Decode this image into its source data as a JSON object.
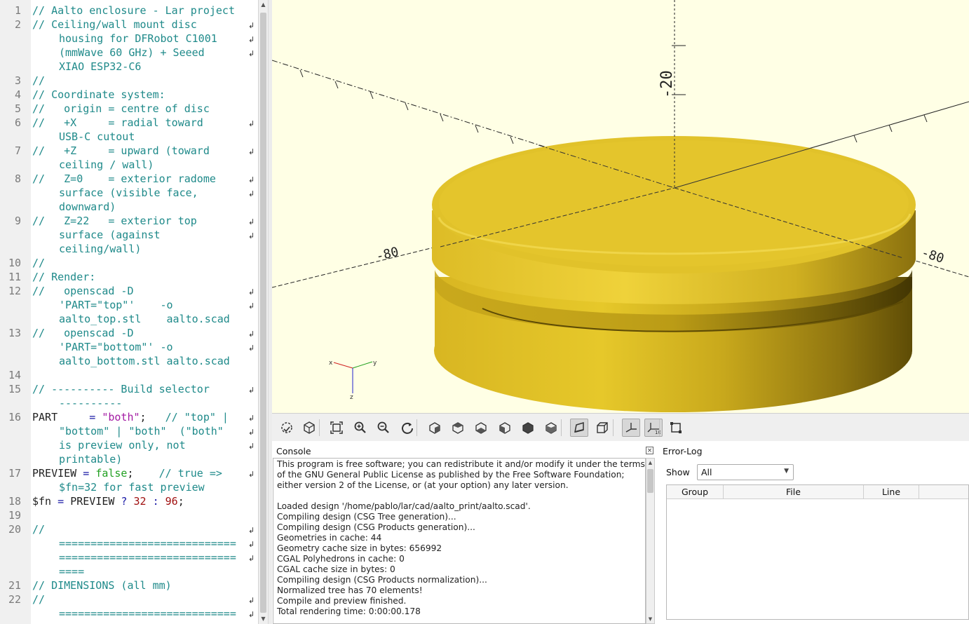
{
  "editor": {
    "lines": [
      {
        "n": "1",
        "rows": [
          {
            "w": false,
            "parts": [
              {
                "t": "// Aalto enclosure - Lar project",
                "c": "cmt"
              }
            ]
          }
        ]
      },
      {
        "n": "2",
        "rows": [
          {
            "w": false,
            "wrap": true,
            "parts": [
              {
                "t": "// Ceiling/wall mount disc",
                "c": "cmt"
              }
            ]
          },
          {
            "w": true,
            "wrap": true,
            "parts": [
              {
                "t": "housing for DFRobot C1001",
                "c": "cmt"
              }
            ]
          },
          {
            "w": true,
            "wrap": true,
            "parts": [
              {
                "t": "(mmWave 60 GHz) + Seeed",
                "c": "cmt"
              }
            ]
          },
          {
            "w": true,
            "parts": [
              {
                "t": "XIAO ESP32-C6",
                "c": "cmt"
              }
            ]
          }
        ]
      },
      {
        "n": "3",
        "rows": [
          {
            "w": false,
            "parts": [
              {
                "t": "//",
                "c": "cmt"
              }
            ]
          }
        ]
      },
      {
        "n": "4",
        "rows": [
          {
            "w": false,
            "parts": [
              {
                "t": "// Coordinate system:",
                "c": "cmt"
              }
            ]
          }
        ]
      },
      {
        "n": "5",
        "rows": [
          {
            "w": false,
            "parts": [
              {
                "t": "//   origin = centre of disc",
                "c": "cmt"
              }
            ]
          }
        ]
      },
      {
        "n": "6",
        "rows": [
          {
            "w": false,
            "wrap": true,
            "parts": [
              {
                "t": "//   +X     = radial toward",
                "c": "cmt"
              }
            ]
          },
          {
            "w": true,
            "parts": [
              {
                "t": "USB-C cutout",
                "c": "cmt"
              }
            ]
          }
        ]
      },
      {
        "n": "7",
        "rows": [
          {
            "w": false,
            "wrap": true,
            "parts": [
              {
                "t": "//   +Z     = upward (toward",
                "c": "cmt"
              }
            ]
          },
          {
            "w": true,
            "parts": [
              {
                "t": "ceiling / wall)",
                "c": "cmt"
              }
            ]
          }
        ]
      },
      {
        "n": "8",
        "rows": [
          {
            "w": false,
            "wrap": true,
            "parts": [
              {
                "t": "//   Z=0    = exterior radome",
                "c": "cmt"
              }
            ]
          },
          {
            "w": true,
            "wrap": true,
            "parts": [
              {
                "t": "surface (visible face,",
                "c": "cmt"
              }
            ]
          },
          {
            "w": true,
            "parts": [
              {
                "t": "downward)",
                "c": "cmt"
              }
            ]
          }
        ]
      },
      {
        "n": "9",
        "rows": [
          {
            "w": false,
            "wrap": true,
            "parts": [
              {
                "t": "//   Z=22   = exterior top",
                "c": "cmt"
              }
            ]
          },
          {
            "w": true,
            "wrap": true,
            "parts": [
              {
                "t": "surface (against",
                "c": "cmt"
              }
            ]
          },
          {
            "w": true,
            "parts": [
              {
                "t": "ceiling/wall)",
                "c": "cmt"
              }
            ]
          }
        ]
      },
      {
        "n": "10",
        "rows": [
          {
            "w": false,
            "parts": [
              {
                "t": "//",
                "c": "cmt"
              }
            ]
          }
        ]
      },
      {
        "n": "11",
        "rows": [
          {
            "w": false,
            "parts": [
              {
                "t": "// Render:",
                "c": "cmt"
              }
            ]
          }
        ]
      },
      {
        "n": "12",
        "rows": [
          {
            "w": false,
            "wrap": true,
            "parts": [
              {
                "t": "//   openscad -D",
                "c": "cmt"
              }
            ]
          },
          {
            "w": true,
            "wrap": true,
            "parts": [
              {
                "t": "'PART=\"top\"'    -o",
                "c": "cmt"
              }
            ]
          },
          {
            "w": true,
            "parts": [
              {
                "t": "aalto_top.stl    aalto.scad",
                "c": "cmt"
              }
            ]
          }
        ]
      },
      {
        "n": "13",
        "rows": [
          {
            "w": false,
            "wrap": true,
            "parts": [
              {
                "t": "//   openscad -D",
                "c": "cmt"
              }
            ]
          },
          {
            "w": true,
            "wrap": true,
            "parts": [
              {
                "t": "'PART=\"bottom\"' -o",
                "c": "cmt"
              }
            ]
          },
          {
            "w": true,
            "parts": [
              {
                "t": "aalto_bottom.stl aalto.scad",
                "c": "cmt"
              }
            ]
          }
        ]
      },
      {
        "n": "14",
        "rows": [
          {
            "w": false,
            "parts": []
          }
        ]
      },
      {
        "n": "15",
        "rows": [
          {
            "w": false,
            "wrap": true,
            "parts": [
              {
                "t": "// ---------- Build selector",
                "c": "cmt"
              }
            ]
          },
          {
            "w": true,
            "parts": [
              {
                "t": "----------",
                "c": "cmt"
              }
            ]
          }
        ]
      },
      {
        "n": "16",
        "rows": [
          {
            "w": false,
            "wrap": true,
            "parts": [
              {
                "t": "PART",
                "c": ""
              },
              {
                "t": "     = ",
                "c": "op"
              },
              {
                "t": "\"both\"",
                "c": "str"
              },
              {
                "t": ";   ",
                "c": ""
              },
              {
                "t": "// \"top\" |",
                "c": "cmt"
              }
            ]
          },
          {
            "w": true,
            "wrap": true,
            "parts": [
              {
                "t": "\"bottom\" | \"both\"  (\"both\"",
                "c": "cmt"
              }
            ]
          },
          {
            "w": true,
            "wrap": true,
            "parts": [
              {
                "t": "is preview only, not",
                "c": "cmt"
              }
            ]
          },
          {
            "w": true,
            "parts": [
              {
                "t": "printable)",
                "c": "cmt"
              }
            ]
          }
        ]
      },
      {
        "n": "17",
        "rows": [
          {
            "w": false,
            "wrap": true,
            "parts": [
              {
                "t": "PREVIEW",
                "c": ""
              },
              {
                "t": " = ",
                "c": "op"
              },
              {
                "t": "false",
                "c": "kw"
              },
              {
                "t": ";    ",
                "c": ""
              },
              {
                "t": "// true =>",
                "c": "cmt"
              }
            ]
          },
          {
            "w": true,
            "parts": [
              {
                "t": "$fn=32 for fast preview",
                "c": "cmt"
              }
            ]
          }
        ]
      },
      {
        "n": "18",
        "rows": [
          {
            "w": false,
            "parts": [
              {
                "t": "$fn",
                "c": ""
              },
              {
                "t": " = ",
                "c": "op"
              },
              {
                "t": "PREVIEW",
                "c": ""
              },
              {
                "t": " ? ",
                "c": "op"
              },
              {
                "t": "32",
                "c": "num"
              },
              {
                "t": " : ",
                "c": "op"
              },
              {
                "t": "96",
                "c": "num"
              },
              {
                "t": ";",
                "c": ""
              }
            ]
          }
        ]
      },
      {
        "n": "19",
        "rows": [
          {
            "w": false,
            "parts": []
          }
        ]
      },
      {
        "n": "20",
        "rows": [
          {
            "w": false,
            "wrap": true,
            "parts": [
              {
                "t": "//",
                "c": "cmt"
              }
            ]
          },
          {
            "w": true,
            "wrap": true,
            "parts": [
              {
                "t": "============================",
                "c": "cmt"
              }
            ]
          },
          {
            "w": true,
            "wrap": true,
            "parts": [
              {
                "t": "============================",
                "c": "cmt"
              }
            ]
          },
          {
            "w": true,
            "parts": [
              {
                "t": "====",
                "c": "cmt"
              }
            ]
          }
        ]
      },
      {
        "n": "21",
        "rows": [
          {
            "w": false,
            "parts": [
              {
                "t": "// DIMENSIONS (all mm)",
                "c": "cmt"
              }
            ]
          }
        ]
      },
      {
        "n": "22",
        "rows": [
          {
            "w": false,
            "wrap": true,
            "parts": [
              {
                "t": "//",
                "c": "cmt"
              }
            ]
          },
          {
            "w": true,
            "wrap": true,
            "parts": [
              {
                "t": "============================",
                "c": "cmt"
              }
            ]
          }
        ]
      }
    ]
  },
  "viewport": {
    "background": "#ffffe5",
    "model_color": "#e3c42a",
    "axis_labels": {
      "z_upper": "-20",
      "left_tick": "-80",
      "right_tick": "-80"
    },
    "axes_gizmo": {
      "x": "x",
      "y": "y",
      "z": "z"
    }
  },
  "toolbar": {
    "buttons": [
      {
        "name": "preview-button",
        "icon": "preview-icon"
      },
      {
        "name": "render-button",
        "icon": "render-icon"
      },
      {
        "name": "view-all-button",
        "icon": "view-all-icon"
      },
      {
        "name": "zoom-in-button",
        "icon": "zoom-in-icon"
      },
      {
        "name": "zoom-out-button",
        "icon": "zoom-out-icon"
      },
      {
        "name": "reset-view-button",
        "icon": "reset-view-icon"
      },
      {
        "name": "view-right-button",
        "icon": "view-right-icon"
      },
      {
        "name": "view-top-button",
        "icon": "view-top-icon"
      },
      {
        "name": "view-bottom-button",
        "icon": "view-bottom-icon"
      },
      {
        "name": "view-left-button",
        "icon": "view-left-icon"
      },
      {
        "name": "view-front-button",
        "icon": "view-front-icon"
      },
      {
        "name": "view-back-button",
        "icon": "view-back-icon"
      },
      {
        "name": "perspective-button",
        "icon": "perspective-icon",
        "active": true
      },
      {
        "name": "orthogonal-button",
        "icon": "orthogonal-icon"
      },
      {
        "name": "show-axes-button",
        "icon": "axes-icon",
        "active": true
      },
      {
        "name": "show-scale-markers-button",
        "icon": "scale-markers-icon",
        "active": true
      },
      {
        "name": "show-edges-button",
        "icon": "edges-icon"
      }
    ]
  },
  "console": {
    "title": "Console",
    "lines": [
      "This program is free software; you can redistribute it and/or modify it under the terms",
      "of the GNU General Public License as published by the Free Software Foundation;",
      "either version 2 of the License, or (at your option) any later version.",
      "",
      "Loaded design '/home/pablo/lar/cad/aalto_print/aalto.scad'.",
      "Compiling design (CSG Tree generation)...",
      "Compiling design (CSG Products generation)...",
      "Geometries in cache: 44",
      "Geometry cache size in bytes: 656992",
      "CGAL Polyhedrons in cache: 0",
      "CGAL cache size in bytes: 0",
      "Compiling design (CSG Products normalization)...",
      "Normalized tree has 70 elements!",
      "Compile and preview finished.",
      "Total rendering time: 0:00:00.178"
    ]
  },
  "error_log": {
    "title": "Error-Log",
    "show_label": "Show",
    "show_value": "All",
    "columns": [
      "Group",
      "File",
      "Line"
    ]
  }
}
